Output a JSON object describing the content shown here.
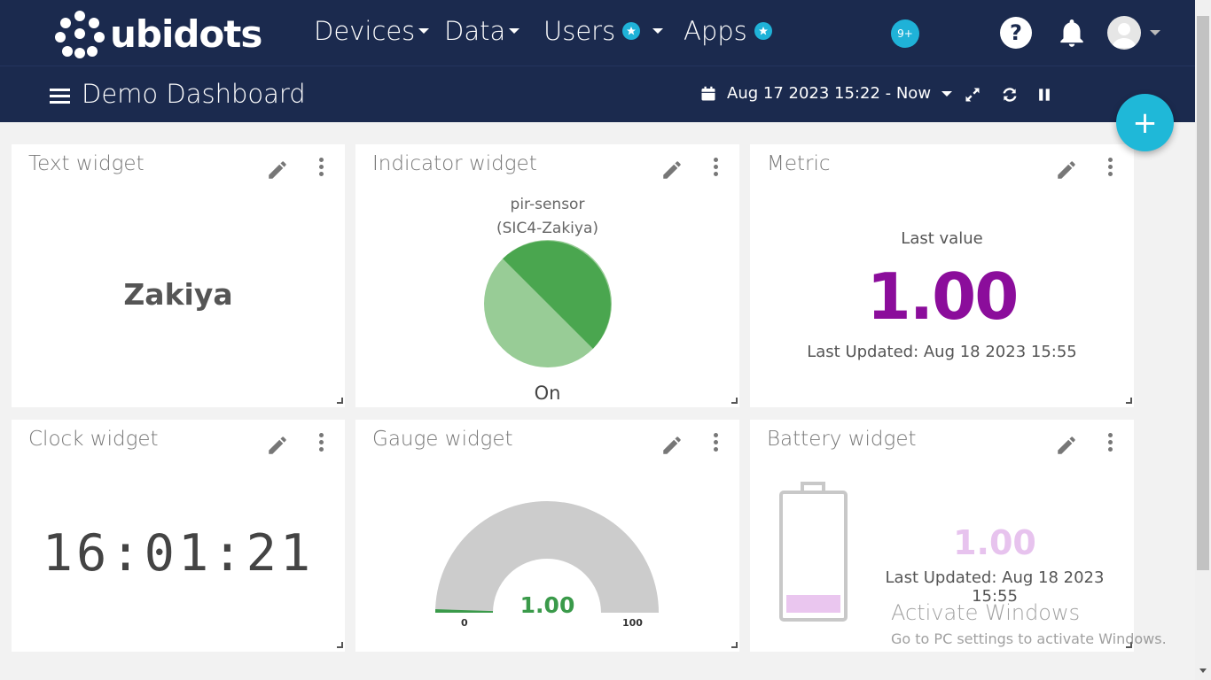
{
  "nav": {
    "brand": "ubidots",
    "items": [
      {
        "label": "Devices",
        "has_star": false
      },
      {
        "label": "Data",
        "has_star": false
      },
      {
        "label": "Users",
        "has_star": true
      },
      {
        "label": "Apps",
        "has_star": true
      }
    ],
    "notification_badge": "9+",
    "help_label": "?"
  },
  "subbar": {
    "title": "Demo Dashboard",
    "date_range": "Aug 17 2023 15:22 - Now"
  },
  "fab_label": "+",
  "widgets": {
    "text": {
      "title": "Text widget",
      "value": "Zakiya"
    },
    "indicator": {
      "title": "Indicator widget",
      "variable": "pir-sensor",
      "device": "(SIC4-Zakiya)",
      "state": "On",
      "color_on": "#4aa64f",
      "color_light": "#98cc96"
    },
    "metric": {
      "title": "Metric",
      "label": "Last value",
      "value": "1.00",
      "updated": "Last Updated: Aug 18 2023 15:55",
      "color": "#8b0d9b"
    },
    "clock": {
      "title": "Clock widget",
      "time": "16:01:21"
    },
    "gauge": {
      "title": "Gauge widget",
      "value": "1.00",
      "min": "0",
      "max": "100",
      "level_fraction": 0.01
    },
    "battery": {
      "title": "Battery widget",
      "value": "1.00",
      "updated": "Last Updated: Aug 18 2023 15:55",
      "fill_color": "#eac6ef"
    }
  },
  "watermark": {
    "title": "Activate Windows",
    "subtitle": "Go to PC settings to activate Windows."
  }
}
